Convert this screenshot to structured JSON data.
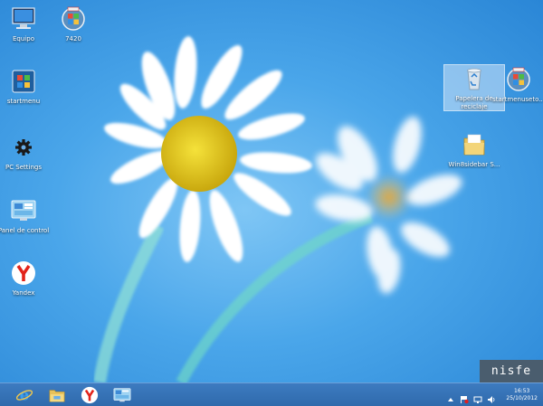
{
  "desktop": {
    "icons": [
      {
        "label": "Equipo",
        "icon": "computer-icon"
      },
      {
        "label": "7420",
        "icon": "installer-icon"
      },
      {
        "label": "startmenu",
        "icon": "startmenu-icon"
      },
      {
        "label": "PC Settings",
        "icon": "gear-icon"
      },
      {
        "label": "Panel de control",
        "icon": "control-panel-icon"
      },
      {
        "label": "Yandex",
        "icon": "yandex-icon"
      },
      {
        "label": "Papelera de reciclaje",
        "icon": "recycle-bin-icon"
      },
      {
        "label": "startmenuseto...",
        "icon": "installer-icon"
      },
      {
        "label": "Win8sidebar S...",
        "icon": "folder-icon"
      }
    ]
  },
  "watermark": "nisfe",
  "taskbar": {
    "pinned": [
      {
        "name": "internet-explorer",
        "icon": "ie-icon"
      },
      {
        "name": "file-explorer",
        "icon": "folder-icon"
      },
      {
        "name": "yandex",
        "icon": "yandex-icon"
      },
      {
        "name": "control-panel",
        "icon": "control-panel-icon"
      }
    ],
    "tray": {
      "time": "16:53",
      "date": "25/10/2012"
    }
  }
}
